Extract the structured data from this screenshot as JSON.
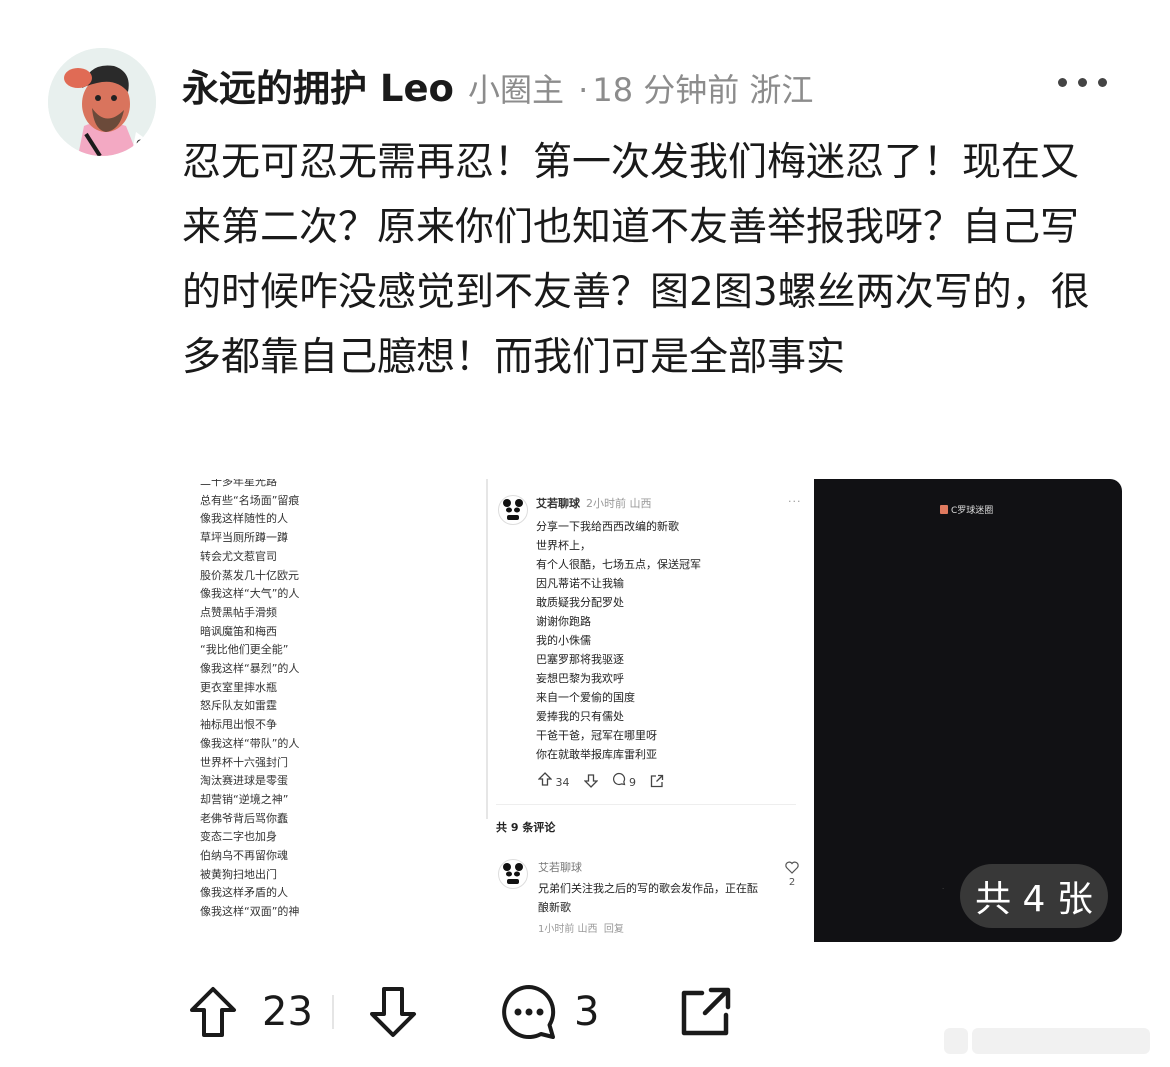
{
  "post": {
    "username": "永远的拥护 Leo",
    "role": "小圈主",
    "separator": "·",
    "time": "18 分钟前",
    "location": "浙江",
    "text": "忍无可忍无需再忍！第一次发我们梅迷忍了！现在又来第二次？原来你们也知道不友善举报我呀？自己写的时候咋没感觉到不友善？图2图3螺丝两次写的，很多都靠自己臆想！而我们可是全部事实"
  },
  "images": {
    "image1_lines": [
      "二十多年星光路",
      "总有些“名场面”留痕",
      "像我这样随性的人",
      "草坪当厕所蹲一蹲",
      "转会尤文惹官司",
      "股价蒸发几十亿欧元",
      "像我这样“大气”的人",
      "点赞黑帖手滑频",
      "暗讽魔笛和梅西",
      "“我比他们更全能”",
      "像我这样“暴烈”的人",
      "更衣室里摔水瓶",
      "怒斥队友如雷霆",
      "袖标甩出恨不争",
      "像我这样“带队”的人",
      "世界杯十六强封门",
      "淘汰赛进球是零蛋",
      "却营销“逆境之神”",
      "老佛爷背后骂你蠢",
      "变态二字也加身",
      "伯纳乌不再留你魂",
      "被黄狗扫地出门",
      "像我这样矛盾的人",
      "像我这样“双面”的神"
    ],
    "image2": {
      "author": "艾若聊球",
      "meta": "2小时前 山西",
      "dots": "···",
      "lines": [
        "分享一下我给西西改编的新歌",
        "世界杯上，",
        "有个人很酷，七场五点，保送冠军",
        "因凡蒂诺不让我输",
        "敢质疑我分配罗处",
        "谢谢你跑路",
        "我的小侏儒",
        "巴塞罗那将我驱逐",
        "妄想巴黎为我欢呼",
        "来自一个爱偷的国度",
        "爱捧我的只有儒处",
        "干爸干爸，冠军在哪里呀",
        "你在就敢举报库库雷利亚"
      ],
      "up_count": "34",
      "comment_count": "9",
      "total_comments": "共 9 条评论",
      "comment_author": "艾若聊球",
      "comment_text": "兄弟们关注我之后的写的歌会发作品，正在酝酿新歌",
      "comment_meta": "1小时前 山西",
      "reply": "回复",
      "like_count": "2"
    },
    "image3": {
      "chip_label": "C罗球迷圈"
    },
    "total_badge": "共 4 张"
  },
  "actions": {
    "upvotes": "23",
    "comments": "3"
  }
}
